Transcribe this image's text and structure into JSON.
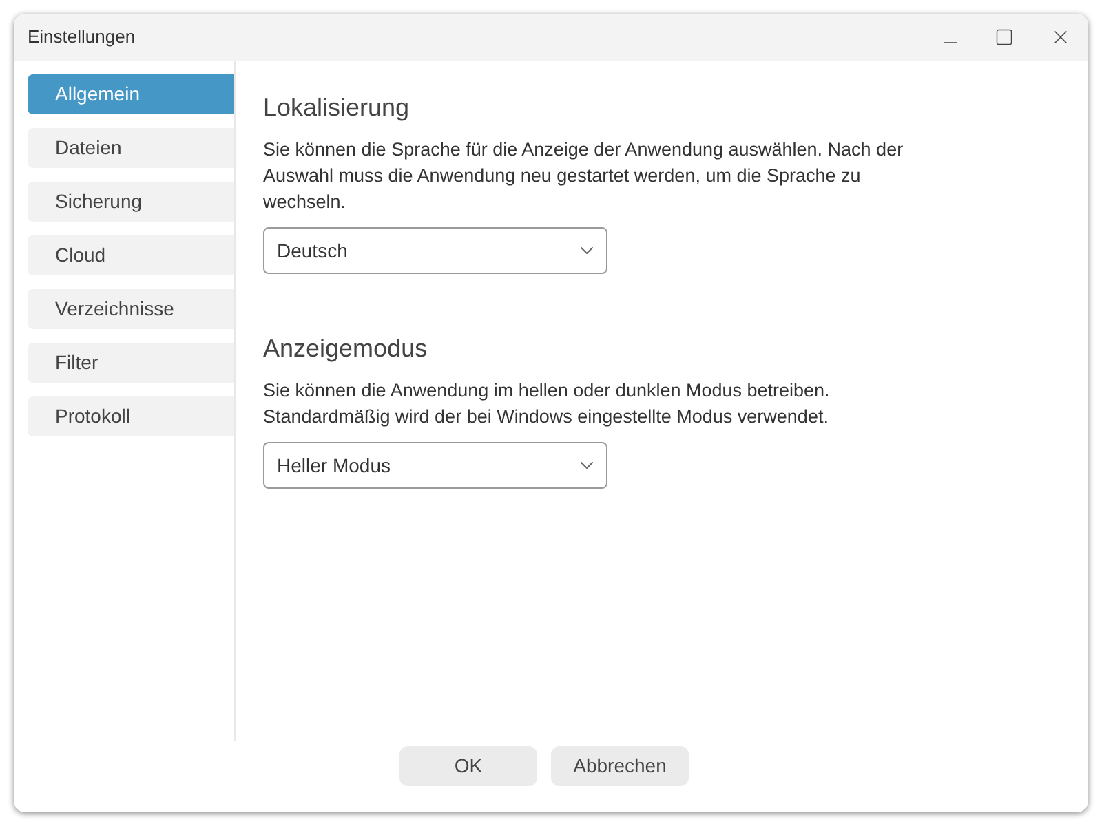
{
  "window": {
    "title": "Einstellungen"
  },
  "sidebar": {
    "items": [
      {
        "label": "Allgemein",
        "selected": true
      },
      {
        "label": "Dateien",
        "selected": false
      },
      {
        "label": "Sicherung",
        "selected": false
      },
      {
        "label": "Cloud",
        "selected": false
      },
      {
        "label": "Verzeichnisse",
        "selected": false
      },
      {
        "label": "Filter",
        "selected": false
      },
      {
        "label": "Protokoll",
        "selected": false
      }
    ]
  },
  "sections": [
    {
      "heading": "Lokalisierung",
      "description": "Sie können die Sprache für die Anzeige der Anwendung auswählen. Nach der Auswahl muss die Anwendung neu gestartet werden, um die Sprache zu wechseln.",
      "select": {
        "value": "Deutsch"
      }
    },
    {
      "heading": "Anzeigemodus",
      "description": "Sie können die Anwendung im hellen oder dunklen Modus betreiben. Standardmäßig wird der bei Windows eingestellte Modus verwendet.",
      "select": {
        "value": "Heller Modus"
      }
    }
  ],
  "buttons": [
    "OK",
    "Abbrechen"
  ]
}
